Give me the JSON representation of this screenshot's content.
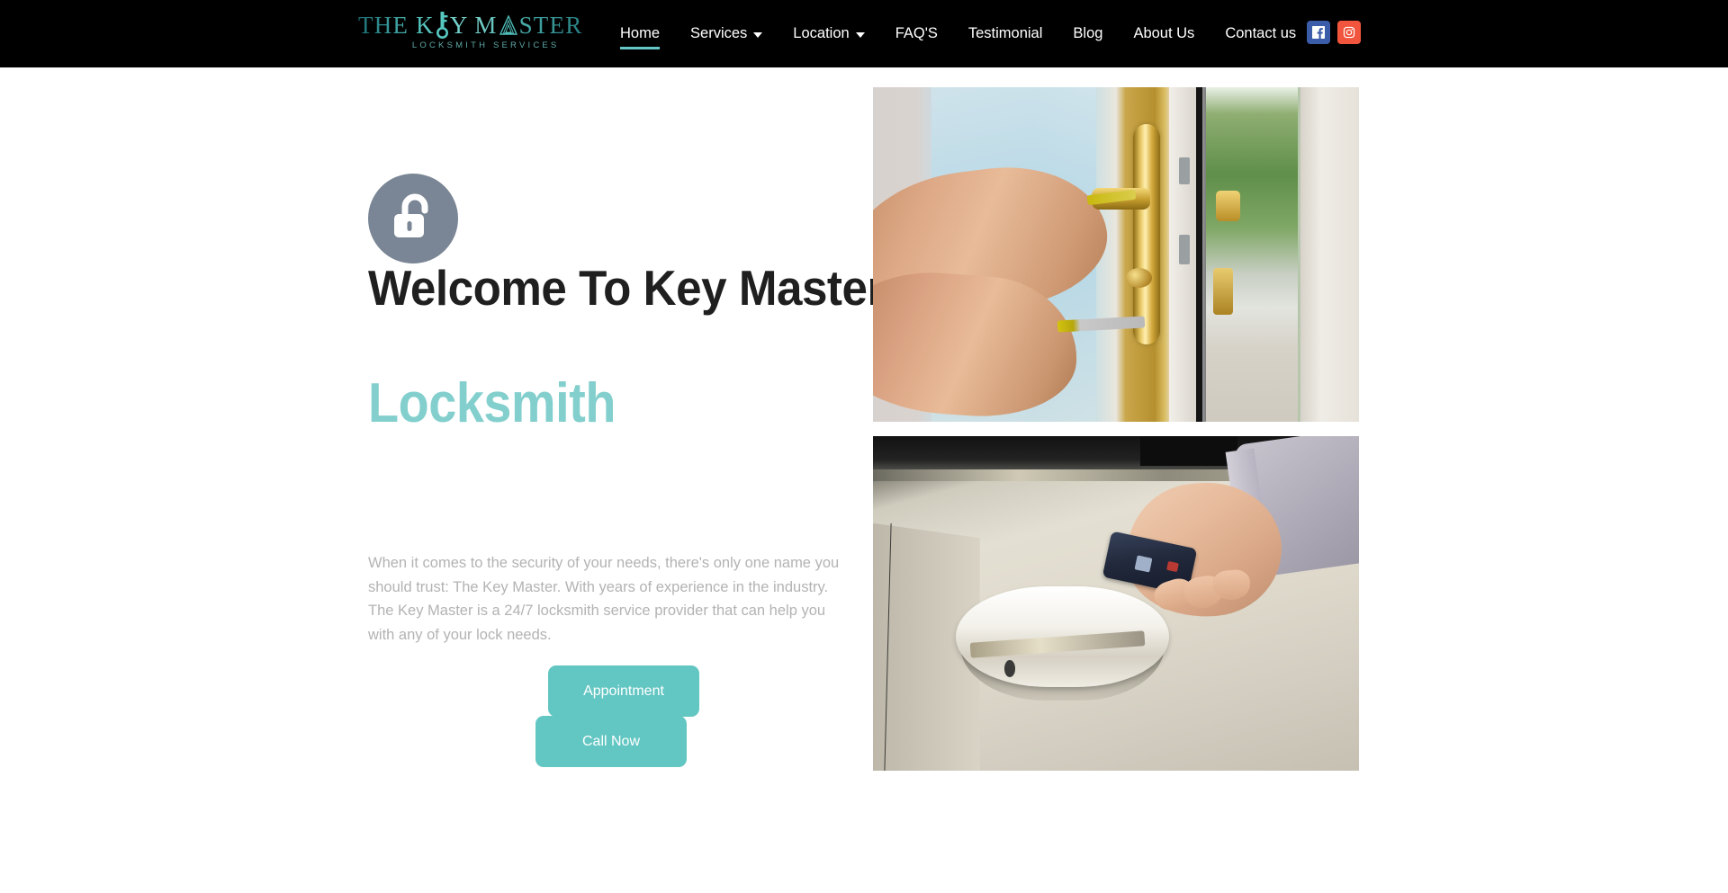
{
  "header": {
    "logo": {
      "text_part1": "THE K",
      "text_key_letter": "E",
      "text_part2": "Y M",
      "text_a_letter": "A",
      "text_part3": "STER",
      "tagline": "LOCKSMITH SERVICES",
      "color": "#3fb3ae"
    },
    "nav": [
      {
        "label": "Home",
        "has_dropdown": false,
        "active": true
      },
      {
        "label": "Services",
        "has_dropdown": true,
        "active": false
      },
      {
        "label": "Location",
        "has_dropdown": true,
        "active": false
      },
      {
        "label": "FAQ'S",
        "has_dropdown": false,
        "active": false
      },
      {
        "label": "Testimonial",
        "has_dropdown": false,
        "active": false
      },
      {
        "label": "Blog",
        "has_dropdown": false,
        "active": false
      },
      {
        "label": "About Us",
        "has_dropdown": false,
        "active": false
      },
      {
        "label": "Contact us",
        "has_dropdown": false,
        "active": false
      }
    ],
    "social": [
      {
        "name": "facebook-icon",
        "label": "Facebook",
        "color": "#3b5ca8"
      },
      {
        "name": "instagram-icon",
        "label": "Instagram",
        "color": "#f2553d"
      }
    ],
    "background_color": "#000000",
    "active_underline_color": "#65c7c7"
  },
  "hero": {
    "icon_name": "open-padlock-icon",
    "icon_circle_color": "#7a8695",
    "title": "Welcome To Key Master",
    "subtitle": "Locksmith",
    "subtitle_color": "#83cfcd",
    "paragraph": "When it comes to the security of your needs, there's only one name you should trust: The Key Master. With years of experience in the industry. The Key Master is a 24/7 locksmith service provider that can help you with any of your lock needs.",
    "buttons": [
      {
        "label": "Appointment",
        "color": "#62c6c2"
      },
      {
        "label": "Call Now",
        "color": "#62c6c2"
      }
    ],
    "images": [
      {
        "name": "locksmith-installing-door-lock-image",
        "alt": "Hands using a screwdriver to install a brass lock on a white door"
      },
      {
        "name": "car-key-fob-image",
        "alt": "Hand holding a car key fob next to a car door handle"
      }
    ]
  }
}
